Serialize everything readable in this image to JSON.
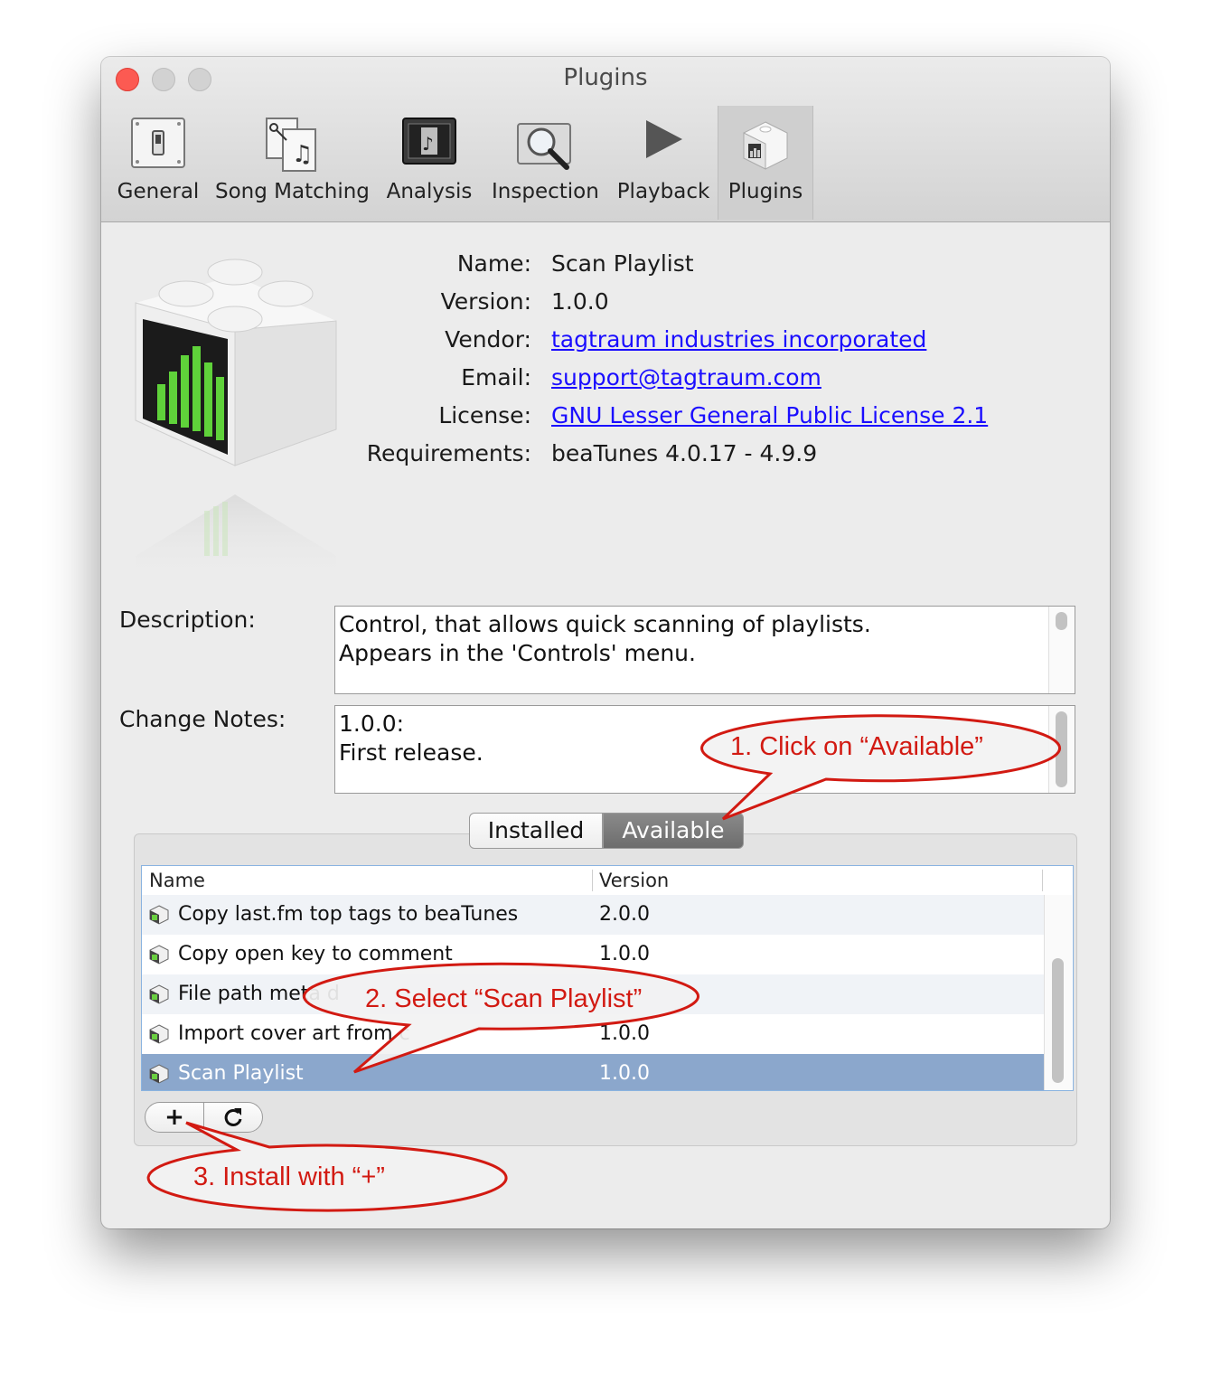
{
  "window": {
    "title": "Plugins"
  },
  "toolbar": [
    {
      "label": "General",
      "icon": "switch-icon"
    },
    {
      "label": "Song Matching",
      "icon": "song-matching-icon"
    },
    {
      "label": "Analysis",
      "icon": "analysis-icon"
    },
    {
      "label": "Inspection",
      "icon": "inspection-icon"
    },
    {
      "label": "Playback",
      "icon": "play-icon"
    },
    {
      "label": "Plugins",
      "icon": "plugin-icon",
      "active": true
    }
  ],
  "plugin": {
    "name_label": "Name:",
    "name": "Scan Playlist",
    "version_label": "Version:",
    "version": "1.0.0",
    "vendor_label": "Vendor:",
    "vendor": "tagtraum industries incorporated",
    "email_label": "Email:",
    "email": "support@tagtraum.com",
    "license_label": "License:",
    "license": "GNU Lesser General Public License 2.1",
    "requirements_label": "Requirements:",
    "requirements": "beaTunes 4.0.17 - 4.9.9",
    "description_label": "Description:",
    "description_lines": [
      "Control, that allows quick scanning of playlists.",
      "Appears in the 'Controls' menu."
    ],
    "change_notes_label": "Change Notes:",
    "change_notes_lines": [
      "1.0.0:",
      "First release."
    ]
  },
  "segmented": {
    "installed": "Installed",
    "available": "Available",
    "selected": "Available"
  },
  "table": {
    "columns": [
      "Name",
      "Version"
    ],
    "rows": [
      {
        "name": "Copy last.fm top tags to beaTunes",
        "version": "2.0.0"
      },
      {
        "name": "Copy open key to comment",
        "version": "1.0.0"
      },
      {
        "name": "File path meta d",
        "version": ""
      },
      {
        "name": "Import cover art from c",
        "version": "1.0.0"
      },
      {
        "name": "Scan Playlist",
        "version": "1.0.0",
        "selected": true
      }
    ],
    "selection_color": "#8ba7cc"
  },
  "buttons": {
    "add": "+",
    "refresh_icon": "refresh-icon"
  },
  "callouts": {
    "step1": "1. Click on “Available”",
    "step2": "2. Select “Scan Playlist”",
    "step3": "3. Install with “+”",
    "color": "#d21a12"
  }
}
